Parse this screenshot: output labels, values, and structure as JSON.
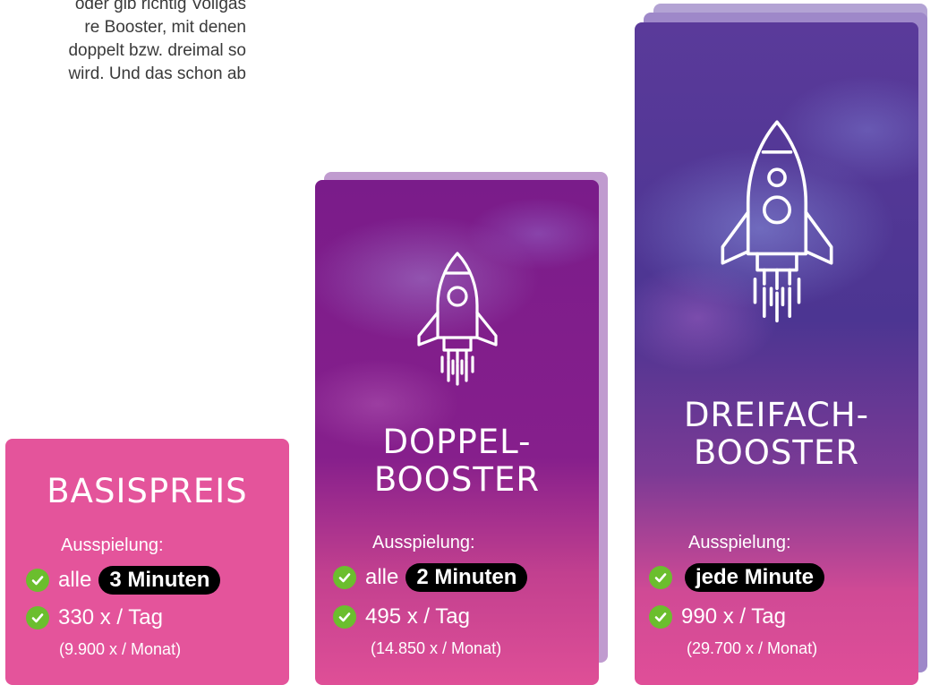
{
  "intro": {
    "lines": [
      "oder gib richtig Vollgas",
      "re Booster, mit denen",
      "doppelt bzw. dreimal so",
      "wird. Und das schon ab"
    ]
  },
  "cards": {
    "basis": {
      "title_line1": "BASISPREIS",
      "ausspielung": "Ausspielung:",
      "freq_prefix": "alle",
      "freq_pill": "3 Minuten",
      "per_day": "330 x / Tag",
      "per_month": "(9.900 x / Monat)"
    },
    "doppel": {
      "title_line1": "DOPPEL-",
      "title_line2": "BOOSTER",
      "ausspielung": "Ausspielung:",
      "freq_prefix": "alle",
      "freq_pill": "2 Minuten",
      "per_day": "495 x / Tag",
      "per_month": "(14.850 x / Monat)"
    },
    "dreifach": {
      "title_line1": "DREIFACH-",
      "title_line2": "BOOSTER",
      "ausspielung": "Ausspielung:",
      "freq_pill": "jede Minute",
      "per_day": "990 x / Tag",
      "per_month": "(29.700 x / Monat)"
    }
  },
  "icons": {
    "rocket": "rocket-icon",
    "check": "check-circle-icon"
  },
  "colors": {
    "basis_card": "#e4549b",
    "doppel_card_top": "#7a1c8a",
    "dreifach_card_top": "#5a3a9a",
    "check_green": "#6bbe2e",
    "pill_bg": "#000000"
  }
}
